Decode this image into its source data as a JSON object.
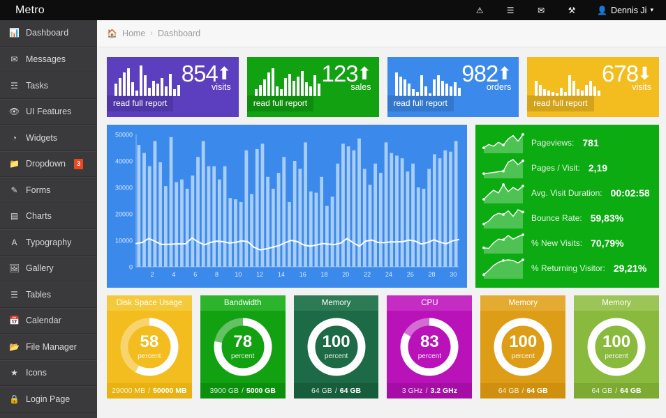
{
  "app": {
    "brand": "Metro"
  },
  "topnav": {
    "icons": [
      {
        "name": "warning-icon",
        "glyph": "⚠"
      },
      {
        "name": "tasks-icon",
        "glyph": "☰"
      },
      {
        "name": "envelope-icon",
        "glyph": "✉"
      },
      {
        "name": "wrench-icon",
        "glyph": "⚒"
      }
    ],
    "user": {
      "avatar_icon": "user-icon",
      "name": "Dennis Ji",
      "caret": "▾"
    }
  },
  "sidebar": {
    "items": [
      {
        "label": "Dashboard",
        "icon": "bar-chart-icon",
        "glyph": "📊",
        "badge": null
      },
      {
        "label": "Messages",
        "icon": "envelope-icon",
        "glyph": "✉",
        "badge": null
      },
      {
        "label": "Tasks",
        "icon": "tasks-icon",
        "glyph": "☲",
        "badge": null
      },
      {
        "label": "UI Features",
        "icon": "eye-icon",
        "glyph": "👁",
        "badge": null
      },
      {
        "label": "Widgets",
        "icon": "dashboard-icon",
        "glyph": "◔",
        "badge": null
      },
      {
        "label": "Dropdown",
        "icon": "folder-icon",
        "glyph": "📁",
        "badge": "3"
      },
      {
        "label": "Forms",
        "icon": "edit-icon",
        "glyph": "✎",
        "badge": null
      },
      {
        "label": "Charts",
        "icon": "chart-area-icon",
        "glyph": "▤",
        "badge": null
      },
      {
        "label": "Typography",
        "icon": "font-icon",
        "glyph": "A",
        "badge": null
      },
      {
        "label": "Gallery",
        "icon": "image-icon",
        "glyph": "🖼",
        "badge": null
      },
      {
        "label": "Tables",
        "icon": "table-icon",
        "glyph": "☰",
        "badge": null
      },
      {
        "label": "Calendar",
        "icon": "calendar-icon",
        "glyph": "📅",
        "badge": null
      },
      {
        "label": "File Manager",
        "icon": "folder-open-icon",
        "glyph": "📂",
        "badge": null
      },
      {
        "label": "Icons",
        "icon": "star-icon",
        "glyph": "★",
        "badge": null
      },
      {
        "label": "Login Page",
        "icon": "lock-icon",
        "glyph": "🔒",
        "badge": null
      }
    ]
  },
  "breadcrumb": {
    "home_icon": "home-icon",
    "home": "Home",
    "separator": "›",
    "current": "Dashboard"
  },
  "tiles": [
    {
      "value": "854",
      "unit": "visits",
      "trend": "up",
      "arrow": "⬆",
      "link": "read full report",
      "color": "#5b3fbf",
      "link_bg": "rgba(0,0,0,0.13)",
      "spark": [
        18,
        26,
        34,
        40,
        20,
        8,
        44,
        30,
        12,
        22,
        18,
        26,
        14,
        32,
        10,
        16
      ]
    },
    {
      "value": "123",
      "unit": "sales",
      "trend": "up",
      "arrow": "⬆",
      "link": "read full report",
      "color": "#11a111",
      "link_bg": "rgba(0,0,0,0.13)",
      "spark": [
        10,
        16,
        24,
        34,
        40,
        14,
        10,
        26,
        32,
        22,
        28,
        36,
        20,
        14,
        30,
        18
      ]
    },
    {
      "value": "982",
      "unit": "orders",
      "trend": "up",
      "arrow": "⬆",
      "link": "read full report",
      "color": "#3b8aeb",
      "link_bg": "rgba(0,0,0,0.13)",
      "spark": [
        34,
        28,
        24,
        18,
        10,
        6,
        30,
        14,
        4,
        24,
        30,
        22,
        18,
        14,
        20,
        12
      ]
    },
    {
      "value": "678",
      "unit": "visits",
      "trend": "down",
      "arrow": "⬇",
      "link": "read full report",
      "color": "#f3bd20",
      "link_bg": "rgba(0,0,0,0.13)",
      "spark": [
        22,
        16,
        10,
        8,
        6,
        4,
        12,
        6,
        30,
        22,
        10,
        8,
        16,
        22,
        14,
        8
      ]
    }
  ],
  "chart_data": {
    "type": "bar",
    "title": "",
    "xlabel": "",
    "ylabel": "",
    "ylim": [
      0,
      50000
    ],
    "yticks": [
      0,
      10000,
      20000,
      30000,
      40000,
      50000
    ],
    "ytick_labels": [
      "0",
      "10000",
      "20000",
      "30000",
      "40000",
      "50000"
    ],
    "xticks": [
      2,
      4,
      6,
      8,
      10,
      12,
      14,
      16,
      18,
      20,
      22,
      24,
      26,
      28,
      30
    ],
    "xtick_labels": [
      "2",
      "4",
      "6",
      "8",
      "10",
      "12",
      "14",
      "16",
      "18",
      "20",
      "22",
      "24",
      "26",
      "28",
      "30"
    ],
    "grid": false,
    "legend": false,
    "bar_color": "#a8cdf7",
    "line_color": "#ffffff",
    "background": "#3b8aeb",
    "categories": [
      1,
      2,
      3,
      4,
      5,
      6,
      7,
      8,
      9,
      10,
      11,
      12,
      13,
      14,
      15,
      16,
      17,
      18,
      19,
      20,
      21,
      22,
      23,
      24,
      25,
      26,
      27,
      28,
      29,
      30,
      31,
      32,
      33,
      34,
      35,
      36,
      37,
      38,
      39,
      40,
      41,
      42,
      43,
      44,
      45,
      46,
      47,
      48,
      49,
      50,
      51,
      52,
      53,
      54,
      55,
      56,
      57,
      58,
      59,
      60
    ],
    "series": [
      {
        "name": "bars",
        "type": "bar",
        "values": [
          46000,
          43000,
          38000,
          47500,
          39500,
          30500,
          49000,
          32000,
          33000,
          29500,
          34500,
          41500,
          47500,
          38000,
          38000,
          33000,
          38000,
          26000,
          25500,
          24500,
          44000,
          27500,
          44500,
          46500,
          34000,
          29500,
          35500,
          41500,
          24500,
          40000,
          37000,
          47000,
          28500,
          28000,
          34000,
          23000,
          26500,
          39000,
          46500,
          45500,
          44000,
          48500,
          37000,
          31000,
          39000,
          35500,
          47000,
          43000,
          42000,
          41000,
          36000,
          39000,
          30000,
          29500,
          37000,
          42500,
          41000,
          44000,
          43500,
          47500
        ]
      },
      {
        "name": "trend",
        "type": "line",
        "values": [
          8800,
          9200,
          10700,
          9700,
          8500,
          8500,
          8600,
          8700,
          8700,
          10900,
          9400,
          8300,
          9200,
          9700,
          9500,
          9000,
          9200,
          9800,
          9500,
          7400,
          6400,
          6800,
          7400,
          8000,
          9100,
          10000,
          9500,
          8300,
          7800,
          8200,
          8800,
          8600,
          8400,
          9000,
          10700,
          9100,
          7800,
          9700,
          10100,
          9200,
          9100,
          9400,
          9400,
          9500,
          10100,
          9700,
          8600,
          9200,
          10200,
          9300,
          8700,
          9800,
          10300
        ]
      }
    ]
  },
  "stats": {
    "background": "#0cab12",
    "rows": [
      {
        "label": "Pageviews:",
        "value": "781",
        "spark": [
          6,
          12,
          9,
          16,
          11,
          22,
          28,
          18,
          30
        ],
        "sparkline_icon": "sparkline-icon"
      },
      {
        "label": "Pages / Visit:",
        "value": "2,19",
        "spark": [
          4,
          5,
          6,
          7,
          8,
          22,
          26,
          18,
          24
        ],
        "sparkline_icon": "sparkline-icon"
      },
      {
        "label": "Avg. Visit Duration:",
        "value": "00:02:58",
        "spark": [
          3,
          10,
          16,
          12,
          24,
          14,
          20,
          16,
          22
        ],
        "sparkline_icon": "sparkline-icon"
      },
      {
        "label": "Bounce Rate:",
        "value": "59,83%",
        "spark": [
          4,
          9,
          18,
          22,
          20,
          26,
          17,
          28,
          24
        ],
        "sparkline_icon": "sparkline-icon"
      },
      {
        "label": "% New Visits:",
        "value": "70,79%",
        "spark": [
          6,
          5,
          14,
          20,
          19,
          26,
          20,
          24,
          27
        ],
        "sparkline_icon": "sparkline-icon"
      },
      {
        "label": "% Returning Visitor:",
        "value": "29,21%",
        "spark": [
          3,
          10,
          18,
          23,
          26,
          27,
          26,
          22,
          27
        ],
        "sparkline_icon": "sparkline-icon"
      }
    ]
  },
  "gauges": [
    {
      "title": "Disk Space Usage",
      "percent": 58,
      "pct_label": "58",
      "word": "percent",
      "used": "29000 MB",
      "sep": "/",
      "total": "50000 MB",
      "bg": "#f3bd20",
      "head_bg": "#f5c93c",
      "foot_bg": "#e8b212",
      "ring_bg": "#ffffff",
      "ring_fg": "rgba(255,255,255,0.35)"
    },
    {
      "title": "Bandwidth",
      "percent": 78,
      "pct_label": "78",
      "word": "percent",
      "used": "3900 GB",
      "sep": "/",
      "total": "5000 GB",
      "bg": "#11a111",
      "head_bg": "#2cb52c",
      "foot_bg": "#0c8f0c",
      "ring_bg": "#ffffff",
      "ring_fg": "rgba(255,255,255,0.35)"
    },
    {
      "title": "Memory",
      "percent": 100,
      "pct_label": "100",
      "word": "percent",
      "used": "64 GB",
      "sep": "/",
      "total": "64 GB",
      "bg": "#1d6b46",
      "head_bg": "#2d7b55",
      "foot_bg": "#175c3b",
      "ring_bg": "#ffffff",
      "ring_fg": "#ffffff"
    },
    {
      "title": "CPU",
      "percent": 83,
      "pct_label": "83",
      "word": "percent",
      "used": "3 GHz",
      "sep": "/",
      "total": "3.2 GHz",
      "bg": "#b812b8",
      "head_bg": "#c42cc4",
      "foot_bg": "#a40ea4",
      "ring_bg": "#ffffff",
      "ring_fg": "rgba(255,255,255,0.38)"
    },
    {
      "title": "Memory",
      "percent": 100,
      "pct_label": "100",
      "word": "percent",
      "used": "64 GB",
      "sep": "/",
      "total": "64 GB",
      "bg": "#dd9d16",
      "head_bg": "#e4ab33",
      "foot_bg": "#cf9010",
      "ring_bg": "#ffffff",
      "ring_fg": "#ffffff"
    },
    {
      "title": "Memory",
      "percent": 100,
      "pct_label": "100",
      "word": "percent",
      "used": "64 GB",
      "sep": "/",
      "total": "64 GB",
      "bg": "#8aba3d",
      "head_bg": "#9bc556",
      "foot_bg": "#7caa32",
      "ring_bg": "#ffffff",
      "ring_fg": "#ffffff"
    }
  ]
}
